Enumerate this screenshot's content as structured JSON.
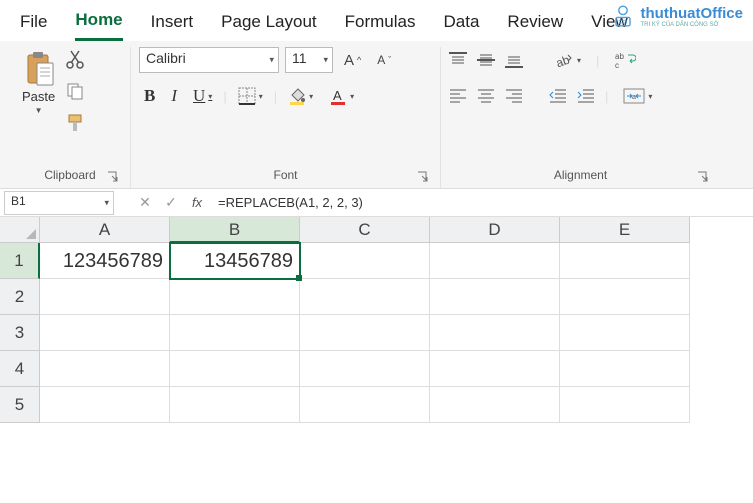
{
  "tabs": {
    "file": "File",
    "home": "Home",
    "insert": "Insert",
    "page_layout": "Page Layout",
    "formulas": "Formulas",
    "data": "Data",
    "review": "Review",
    "view": "View"
  },
  "watermark": {
    "text": "thuthuatOffice",
    "sub": "TRI KỶ CỦA DÂN CÔNG SỞ"
  },
  "ribbon": {
    "clipboard": {
      "label": "Clipboard",
      "paste": "Paste"
    },
    "font": {
      "label": "Font",
      "name": "Calibri",
      "size": "11"
    },
    "alignment": {
      "label": "Alignment"
    }
  },
  "namebox": "B1",
  "formula": "=REPLACEB(A1, 2, 2, 3)",
  "columns": [
    "A",
    "B",
    "C",
    "D",
    "E"
  ],
  "rows": [
    "1",
    "2",
    "3",
    "4",
    "5"
  ],
  "selected_col": "B",
  "selected_row": "1",
  "cells": {
    "A1": "123456789",
    "B1": "13456789"
  }
}
